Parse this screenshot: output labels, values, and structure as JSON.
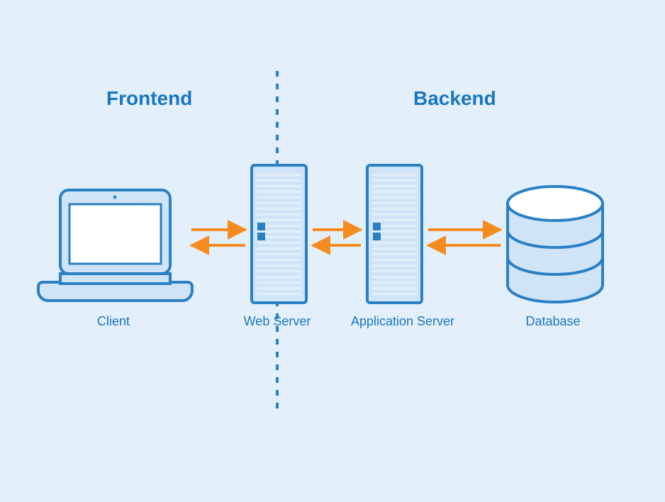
{
  "sections": {
    "frontend": "Frontend",
    "backend": "Backend"
  },
  "nodes": {
    "client": "Client",
    "web": "Web Server",
    "app": "Application Server",
    "database": "Database"
  },
  "colors": {
    "bg": "#e3f0fb",
    "stroke": "#2a7fc5",
    "fill": "#cfe5f7",
    "arrow": "#f68b1f",
    "text": "#1976c1"
  }
}
